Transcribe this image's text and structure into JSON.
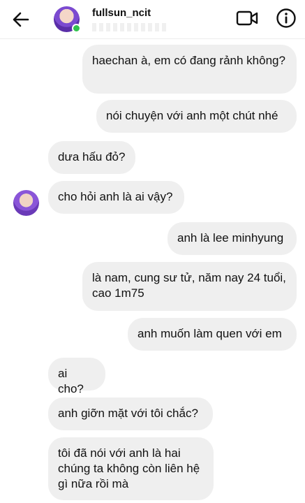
{
  "header": {
    "username": "fullsun_ncit",
    "back_icon": "arrow-left-icon",
    "video_icon": "video-camera-icon",
    "info_icon": "info-icon",
    "online_color": "#31c24d"
  },
  "messages": [
    {
      "sender": "me",
      "text": "haechan à, em có đang rảnh không?"
    },
    {
      "sender": "me",
      "text": "nói chuyện với anh một chút nhé"
    },
    {
      "sender": "other",
      "text": "dưa hấu đỏ?"
    },
    {
      "sender": "other",
      "text": "cho hỏi anh là ai vậy?"
    },
    {
      "sender": "me",
      "text": "anh là lee minhyung"
    },
    {
      "sender": "me",
      "text": "là nam, cung sư tử, năm nay 24 tuổi, cao 1m75"
    },
    {
      "sender": "me",
      "text": "anh muốn làm quen với em"
    },
    {
      "sender": "other",
      "text": "ai cho?"
    },
    {
      "sender": "other",
      "text": "anh giỡn mặt với tôi chắc?"
    },
    {
      "sender": "other",
      "text": "tôi đã nói với anh là hai chúng ta không còn liên hệ gì nữa rồi mà"
    }
  ],
  "colors": {
    "bubble_bg": "#efefef",
    "text": "#111111"
  }
}
